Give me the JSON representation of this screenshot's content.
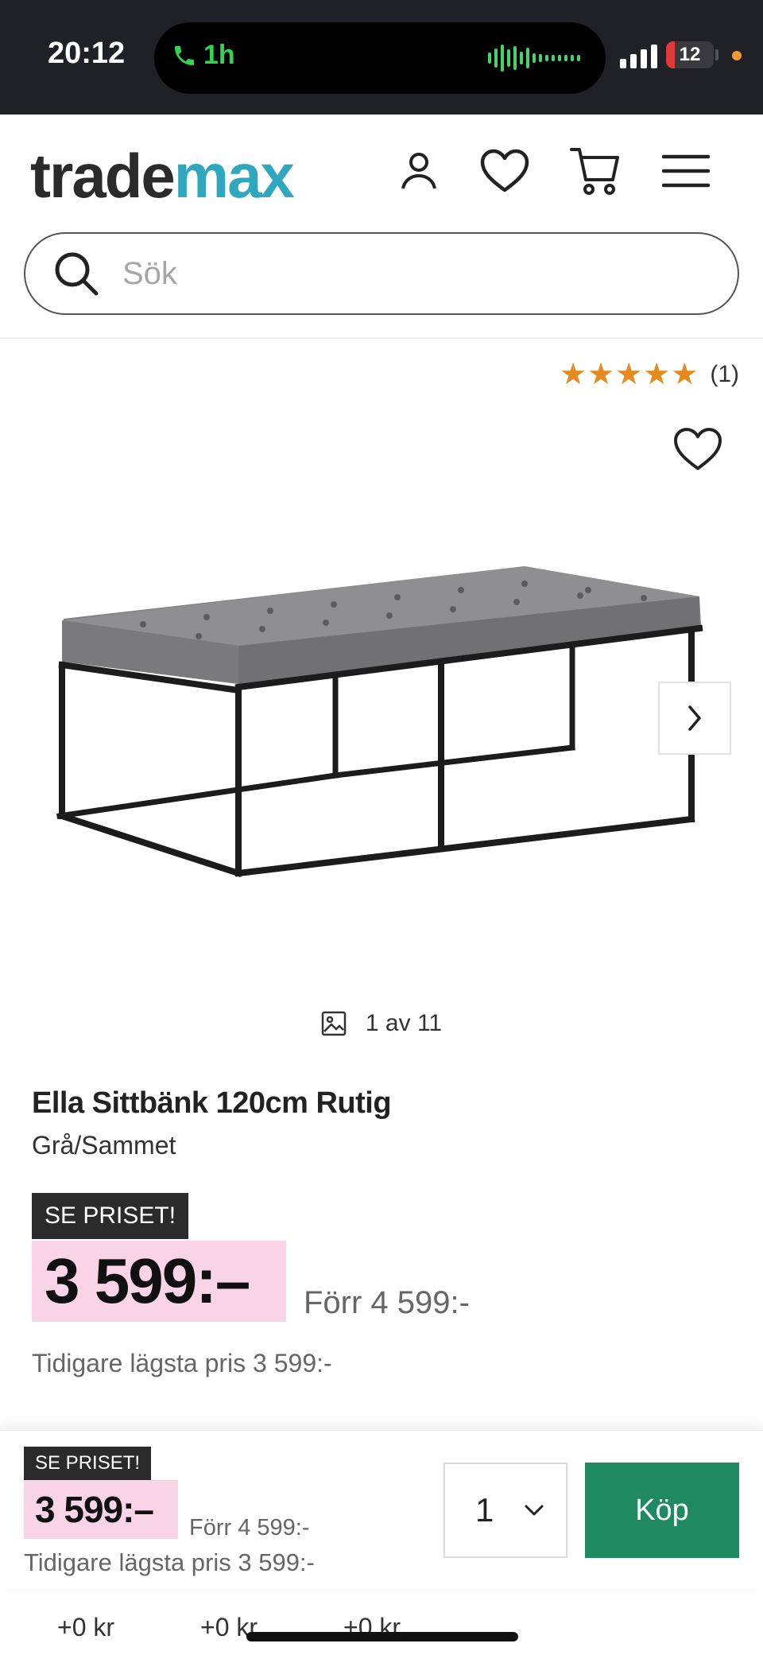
{
  "status_bar": {
    "time": "20:12",
    "call_duration": "1h",
    "battery": "12",
    "battery_fraction": 0.12,
    "icons": [
      "phone-icon",
      "audio-wave-icon",
      "signal-icon",
      "battery-icon",
      "privacy-dot-icon"
    ]
  },
  "header": {
    "logo_part1": "trade",
    "logo_part2": "max",
    "icons": [
      "account-icon",
      "heart-icon",
      "cart-icon",
      "menu-icon"
    ],
    "search_placeholder": "Sök"
  },
  "product": {
    "rating_stars": "★★★★★",
    "rating_value": 5,
    "rating_count": "(1)",
    "image_counter": "1 av 11",
    "title": "Ella Sittbänk 120cm Rutig",
    "variant": "Grå/Sammet",
    "badge": "SE PRISET!",
    "price": "3 599:–",
    "previous_price": "Förr 4 599:-",
    "lowest_price": "Tidigare lägsta pris 3 599:-"
  },
  "sticky_bar": {
    "badge": "SE PRISET!",
    "price": "3 599:–",
    "previous_price": "Förr 4 599:-",
    "lowest_price": "Tidigare lägsta pris 3 599:-",
    "quantity": "1",
    "buy_label": "Köp"
  },
  "bottom_row": [
    "+0 kr",
    "+0 kr",
    "+0 kr"
  ],
  "colors": {
    "accent_green": "#1f8a5f",
    "price_highlight": "#f9d3e6",
    "logo_teal": "#2ea7bf",
    "star_orange": "#e58a20"
  }
}
